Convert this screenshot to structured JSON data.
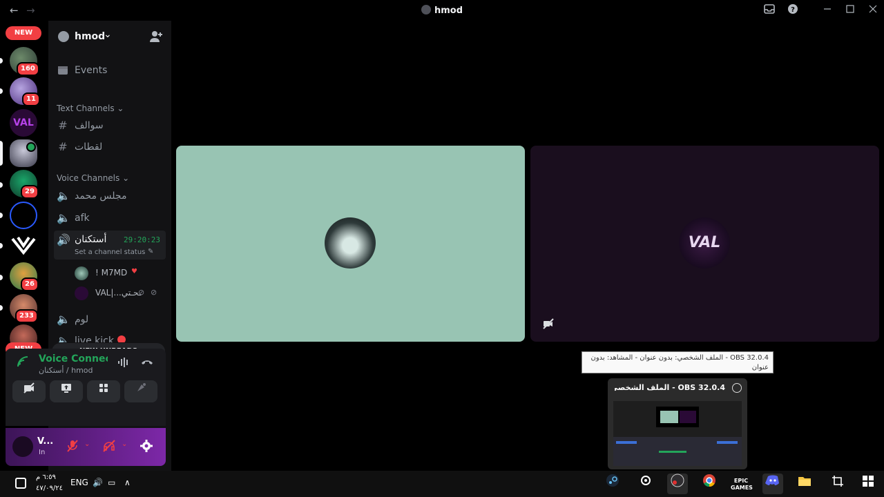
{
  "window": {
    "title": "hmod",
    "back": "←",
    "forward": "→"
  },
  "servers": {
    "new_top": "NEW",
    "new_bottom": "NEW",
    "badges": [
      "160",
      "11",
      "29",
      "26",
      "233"
    ]
  },
  "guild": {
    "name": "hmod",
    "chevron": "⌄"
  },
  "events_label": "Events",
  "text_category": "Text Channels",
  "text_channels": [
    "سوالف",
    "لقطات"
  ],
  "voice_category": "Voice Channels",
  "voice_channels": {
    "ch1": "مجلس محمد",
    "ch2": "afk",
    "active": "أستكنان",
    "active_timer": "29:20:23",
    "active_status": "Set a channel status",
    "ch4": "لوم",
    "ch5": "live kick"
  },
  "members": [
    {
      "name": "! M7MD"
    },
    {
      "name": "VAL|...ـحـتي"
    }
  ],
  "new_unreads": "NEW UNREADS",
  "voice_panel": {
    "title": "Voice Connected",
    "subtitle": "أستكنان / hmod"
  },
  "user_panel": {
    "name": "V...",
    "status": "In"
  },
  "tiles": {
    "left_color": "#98c4b3",
    "right_color": "#1a0e1e"
  },
  "tooltip": "OBS 32.0.4 - الملف الشخصي: بدون عنوان - المشاهد: بدون عنوان",
  "thumbnail_title": "OBS 32.0.4 - الملف الشخصي: بدو...",
  "taskbar": {
    "lang": "ENG",
    "time": "٦:٥٩ م",
    "date": "٤٧/٠٩/٢٤"
  },
  "colors": {
    "accent_green": "#23a55a",
    "danger": "#f23f43",
    "blurple": "#5865f2"
  }
}
